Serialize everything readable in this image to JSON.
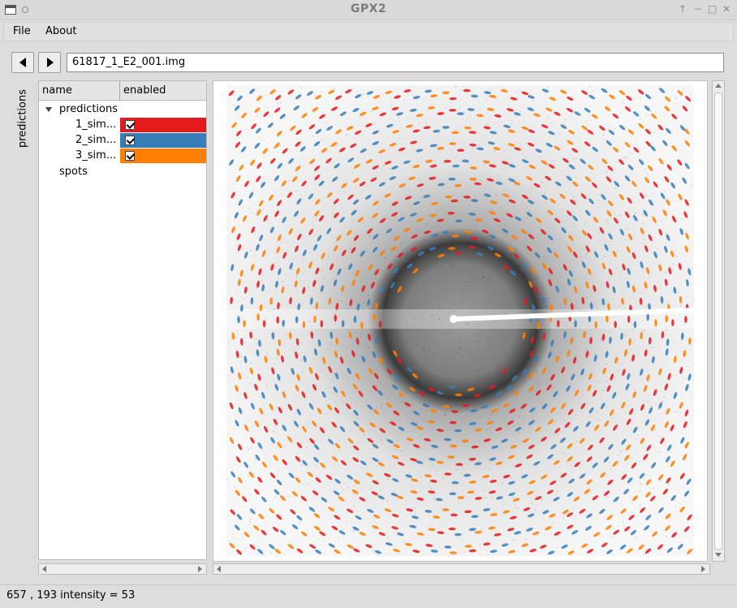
{
  "window": {
    "title": "GPX2"
  },
  "menu": {
    "file": "File",
    "about": "About"
  },
  "toolbar": {
    "filename": "61817_1_E2_001.img"
  },
  "sidebar": {
    "tab_label": "predictions"
  },
  "tree": {
    "col_name": "name",
    "col_enabled": "enabled",
    "root": "predictions",
    "items": [
      {
        "label": "1_sim...",
        "color": "#e41a1c",
        "enabled": true
      },
      {
        "label": "2_sim...",
        "color": "#377eb8",
        "enabled": true
      },
      {
        "label": "3_sim...",
        "color": "#ff7f00",
        "enabled": true
      }
    ],
    "spots": "spots"
  },
  "status": {
    "text": "657 , 193  intensity = 53"
  },
  "colors": {
    "red": "#e41a1c",
    "blue": "#377eb8",
    "orange": "#ff7f00"
  }
}
